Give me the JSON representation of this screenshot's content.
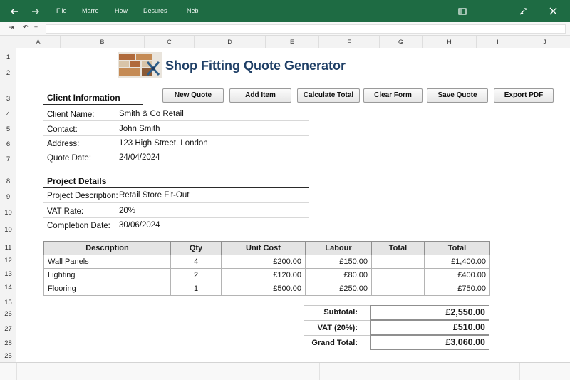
{
  "titlebar": {
    "back_icon": "arrow-left-icon",
    "forward_icon": "arrow-right-icon",
    "menus": [
      "Filo",
      "Marro",
      "How",
      "Desures",
      "Neb"
    ],
    "window_icons": [
      "restore-icon",
      "settings-icon",
      "close-icon"
    ],
    "background": "#1e6b43"
  },
  "formula_bar": {
    "left_glyphs": [
      "⇥",
      "↶",
      "÷"
    ]
  },
  "columns": [
    "A",
    "B",
    "C",
    "D",
    "E",
    "F",
    "G",
    "H",
    "I",
    "J"
  ],
  "rows": [
    "1",
    "2",
    "3",
    "4",
    "5",
    "6",
    "7",
    "8",
    "9",
    "10",
    "10",
    "11",
    "12",
    "13",
    "14",
    "15",
    "26",
    "27",
    "28",
    "25"
  ],
  "app": {
    "title": "Shop Fitting Quote Generator",
    "title_color": "#1f3f66"
  },
  "buttons": [
    "New Quote",
    "Add Item",
    "Calculate Total",
    "Clear Form",
    "Save Quote",
    "Export PDF"
  ],
  "client": {
    "heading": "Client Information",
    "name_label": "Client Name:",
    "name": "Smith & Co Retail",
    "contact_label": "Contact:",
    "contact": "John Smith",
    "address_label": "Address:",
    "address": "123 High Street, London",
    "date_label": "Quote Date:",
    "date": "24/04/2024"
  },
  "project": {
    "heading": "Project Details",
    "desc_label": "Project Description:",
    "desc": "Retail Store Fit-Out",
    "vat_label": "VAT Rate:",
    "vat": "20%",
    "completion_label": "Completion Date:",
    "completion": "30/06/2024"
  },
  "items_table": {
    "headers": [
      "Description",
      "Qty",
      "Unit Cost",
      "Labour",
      "Total",
      "Total"
    ],
    "rows": [
      [
        "Wall Panels",
        "4",
        "£200.00",
        "£150.00",
        "",
        "£1,400.00"
      ],
      [
        "Lighting",
        "2",
        "£120.00",
        "£80.00",
        "",
        "£400.00"
      ],
      [
        "Flooring",
        "1",
        "£500.00",
        "£250.00",
        "",
        "£750.00"
      ]
    ]
  },
  "totals": {
    "subtotal_label": "Subtotal:",
    "subtotal": "£2,550.00",
    "vat_label": "VAT (20%):",
    "vat": "£510.00",
    "grand_label": "Grand Total:",
    "grand": "£3,060.00"
  }
}
